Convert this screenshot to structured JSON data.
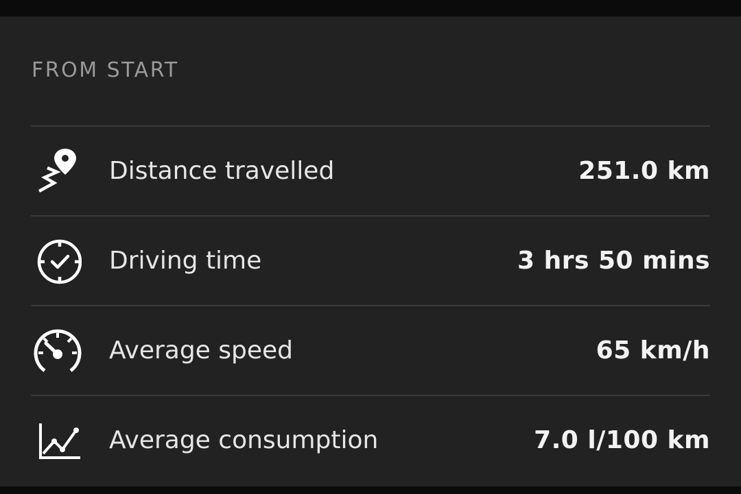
{
  "section": {
    "title": "FROM START"
  },
  "stats": [
    {
      "icon": "route-pin-icon",
      "label": "Distance travelled",
      "value": "251.0 km"
    },
    {
      "icon": "clock-icon",
      "label": "Driving time",
      "value": "3 hrs 50 mins"
    },
    {
      "icon": "speedometer-icon",
      "label": "Average speed",
      "value": "65 km/h"
    },
    {
      "icon": "line-chart-icon",
      "label": "Average consumption",
      "value": "7.0 l/100 km"
    }
  ],
  "colors": {
    "panel_bg": "#222222",
    "outer_bg": "#0b0b0b",
    "divider": "#3a3a3a",
    "title_text": "#9a9a9a",
    "label_text": "#e6e6e6",
    "value_text": "#f2f2f2"
  }
}
